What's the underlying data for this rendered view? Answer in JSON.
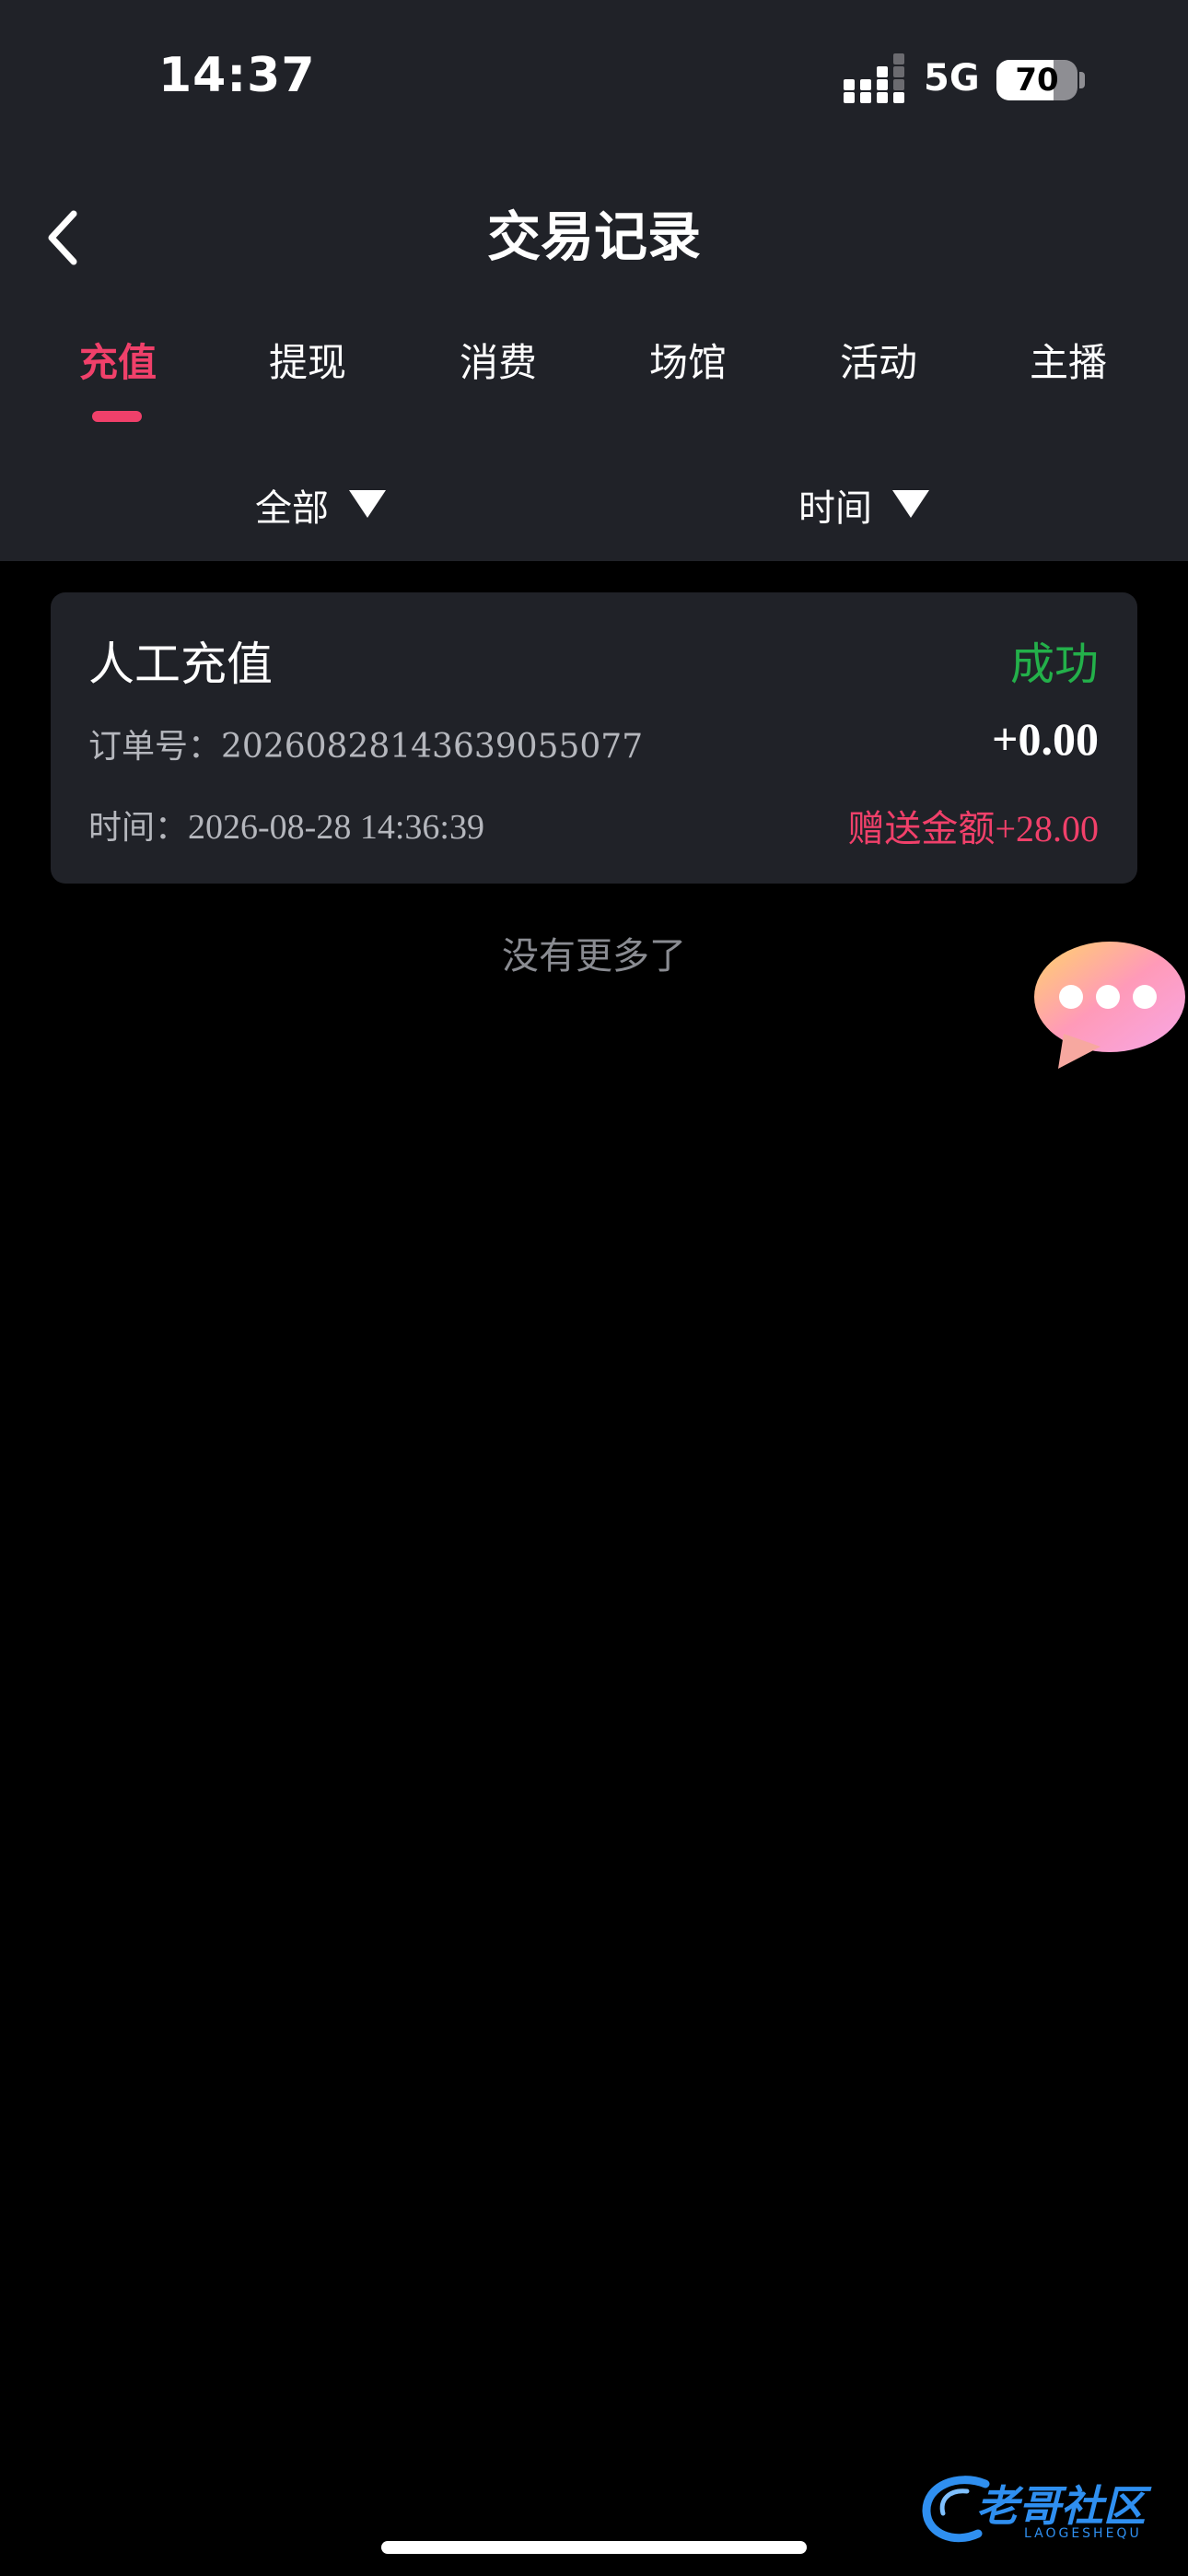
{
  "status_bar": {
    "time": "14:37",
    "network": "5G",
    "battery": "70",
    "battery_level_percent": 70
  },
  "nav": {
    "title": "交易记录",
    "back_icon": "chevron-left-icon"
  },
  "tabs": [
    {
      "label": "充值",
      "active": true
    },
    {
      "label": "提现",
      "active": false
    },
    {
      "label": "消费",
      "active": false
    },
    {
      "label": "场馆",
      "active": false
    },
    {
      "label": "活动",
      "active": false
    },
    {
      "label": "主播",
      "active": false
    }
  ],
  "filters": {
    "type_label": "全部",
    "time_label": "时间",
    "icon": "triangle-down-icon"
  },
  "records": [
    {
      "type": "人工充值",
      "status": "成功",
      "order_label": "订单号：",
      "order_no": "20260828143639055077",
      "amount": "+0.00",
      "time_label": "时间：",
      "time": "2026-08-28 14:36:39",
      "bonus_label": "赠送金额",
      "bonus_value": "+28.00"
    }
  ],
  "list_end_text": "没有更多了",
  "colors": {
    "accent": "#f0406a",
    "success": "#23b04a",
    "header_bg": "#202228",
    "page_bg": "#000000"
  },
  "watermark": {
    "text": "老哥社区",
    "sub": "LAOGESHEQU"
  }
}
